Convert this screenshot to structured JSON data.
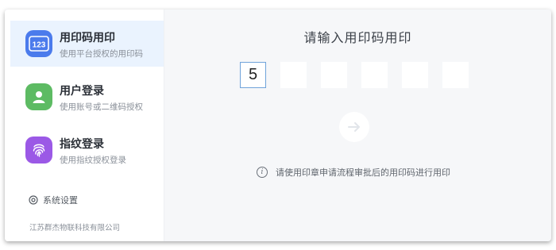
{
  "sidebar": {
    "items": [
      {
        "title": "用印码用印",
        "subtitle": "使用平台授权的用印码",
        "icon": "code-123-icon",
        "color": "#4b7bec",
        "active": true
      },
      {
        "title": "用户登录",
        "subtitle": "使用账号或二维码授权",
        "icon": "user-icon",
        "color": "#5dbb63",
        "active": false
      },
      {
        "title": "指纹登录",
        "subtitle": "使用指纹授权登录",
        "icon": "fingerprint-icon",
        "color": "#9b59e6",
        "active": false
      }
    ],
    "settings_label": "系统设置",
    "company": "江苏群杰物联科技有限公司"
  },
  "main": {
    "title": "请输入用印码用印",
    "code_digits": [
      "5",
      "",
      "",
      "",
      "",
      ""
    ],
    "hint": "请使用印章申请流程审批后的用印码进行用印",
    "submit_icon": "arrow-right-icon"
  },
  "colors": {
    "accent": "#4b7bec",
    "focus_border": "#6fa3da",
    "active_bg": "#eaf3fe"
  }
}
